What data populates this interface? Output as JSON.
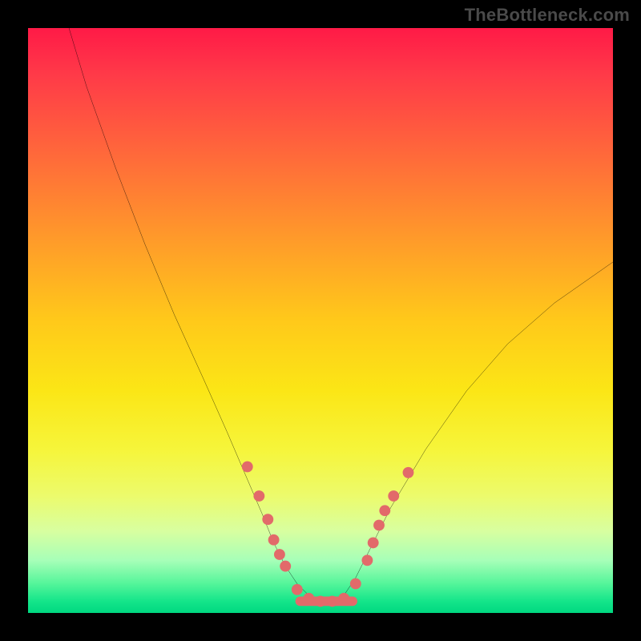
{
  "watermark": "TheBottleneck.com",
  "chart_data": {
    "type": "line",
    "title": "",
    "xlabel": "",
    "ylabel": "",
    "xlim": [
      0,
      100
    ],
    "ylim": [
      0,
      100
    ],
    "series": [
      {
        "name": "curve",
        "x": [
          7,
          10,
          15,
          20,
          25,
          30,
          34,
          37,
          40,
          42,
          44,
          46,
          48,
          50,
          52,
          54,
          56,
          58,
          62,
          68,
          75,
          82,
          90,
          100
        ],
        "y": [
          100,
          90,
          76,
          63,
          51,
          40,
          31,
          24,
          17,
          12,
          8,
          5,
          3,
          2,
          2,
          3,
          6,
          10,
          18,
          28,
          38,
          46,
          53,
          60
        ]
      }
    ],
    "markers": {
      "name": "dots",
      "x": [
        37.5,
        39.5,
        41,
        42,
        43,
        44,
        46,
        48,
        50,
        52,
        54,
        56,
        58,
        59,
        60,
        61,
        62.5,
        65
      ],
      "y": [
        25,
        20,
        16,
        12.5,
        10,
        8,
        4,
        2.5,
        2,
        2,
        2.5,
        5,
        9,
        12,
        15,
        17.5,
        20,
        24
      ]
    },
    "bottom_segment": {
      "x1": 46.5,
      "x2": 55.5,
      "y": 2
    },
    "colors": {
      "curve": "#000000",
      "markers": "#e26a6a",
      "background_top": "#ff1a47",
      "background_bottom": "#00d880"
    }
  }
}
